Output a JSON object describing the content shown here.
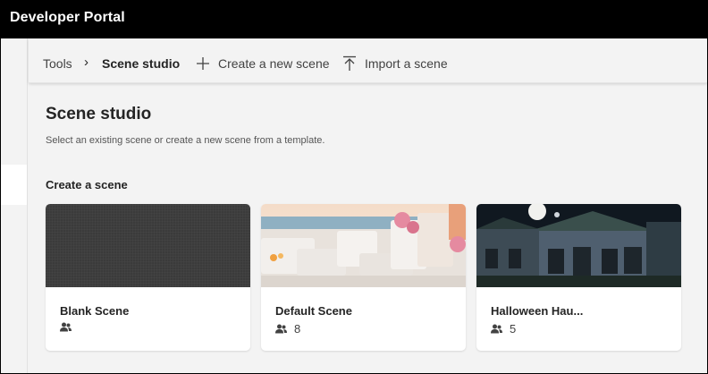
{
  "app": {
    "title": "Developer Portal"
  },
  "breadcrumb": {
    "root": "Tools",
    "separator": "›",
    "current": "Scene studio"
  },
  "commands": {
    "new_label": "Create a new scene",
    "import_label": "Import a scene"
  },
  "page": {
    "title": "Scene studio",
    "subtitle": "Select an existing scene or create a new scene from a template."
  },
  "section": {
    "title": "Create a scene"
  },
  "scenes": [
    {
      "title": "Blank Scene",
      "count": "",
      "icon": "people-icon"
    },
    {
      "title": "Default Scene",
      "count": "8",
      "icon": "people-icon"
    },
    {
      "title": "Halloween Hau...",
      "count": "5",
      "icon": "people-icon"
    }
  ],
  "colors": {
    "topbar": "#000000",
    "background": "#f3f3f3",
    "card": "#ffffff"
  }
}
